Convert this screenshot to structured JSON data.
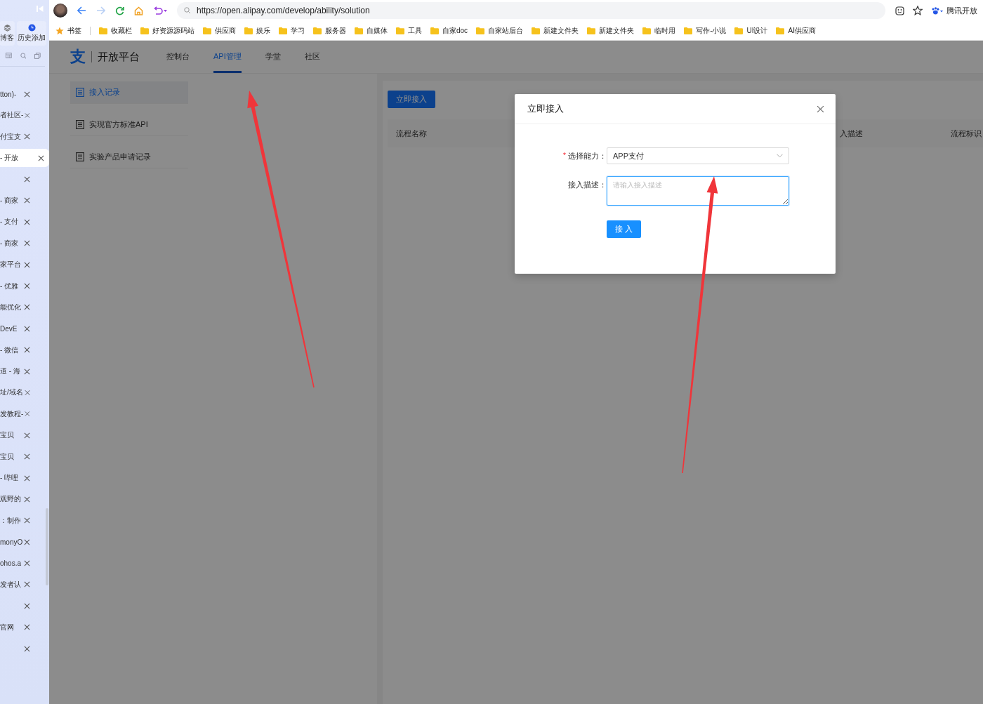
{
  "sidebar": {
    "top_buttons": [
      {
        "label": "博客"
      },
      {
        "label": "历史添加"
      }
    ],
    "tabs": [
      {
        "title": "tton)-",
        "selected": false
      },
      {
        "title": "者社区-",
        "selected": false
      },
      {
        "title": "付宝支",
        "selected": false
      },
      {
        "title": "- 开放",
        "selected": true
      },
      {
        "selected": false
      },
      {
        "title": "- 商家",
        "selected": false
      },
      {
        "title": "- 支付",
        "selected": false
      },
      {
        "title": "- 商家",
        "selected": false
      },
      {
        "title": "家平台",
        "selected": false
      },
      {
        "title": "- 优雅",
        "selected": false
      },
      {
        "title": "能优化",
        "selected": false
      },
      {
        "title": "DevE",
        "selected": false
      },
      {
        "title": "- 微信",
        "selected": false
      },
      {
        "title": "道 - 海",
        "selected": false
      },
      {
        "title": "址/域名",
        "selected": false
      },
      {
        "title": "发教程-",
        "selected": false
      },
      {
        "title": "宝贝",
        "selected": false
      },
      {
        "title": "宝贝",
        "selected": false
      },
      {
        "title": "- 哔哩",
        "selected": false
      },
      {
        "title": "观野的",
        "selected": false
      },
      {
        "title": "：制作",
        "selected": false
      },
      {
        "title": "monyO",
        "selected": false
      },
      {
        "title": "ohos.a",
        "selected": false
      },
      {
        "title": "发者认",
        "selected": false
      },
      {
        "selected": false
      },
      {
        "title": "官网",
        "selected": false
      },
      {
        "selected": false
      }
    ]
  },
  "browser": {
    "url": "https://open.alipay.com/develop/ability/solution",
    "profile_label": "腾讯开放",
    "bookmarks": [
      {
        "label": "书签",
        "kind": "star"
      },
      {
        "label": "收藏栏",
        "kind": "folder"
      },
      {
        "label": "好资源源码站",
        "kind": "folder"
      },
      {
        "label": "供应商",
        "kind": "folder"
      },
      {
        "label": "娱乐",
        "kind": "folder"
      },
      {
        "label": "学习",
        "kind": "folder"
      },
      {
        "label": "服务器",
        "kind": "folder"
      },
      {
        "label": "自媒体",
        "kind": "folder"
      },
      {
        "label": "工具",
        "kind": "folder"
      },
      {
        "label": "自家doc",
        "kind": "folder"
      },
      {
        "label": "自家站后台",
        "kind": "folder"
      },
      {
        "label": "新建文件夹",
        "kind": "folder"
      },
      {
        "label": "新建文件夹",
        "kind": "folder"
      },
      {
        "label": "临时用",
        "kind": "folder"
      },
      {
        "label": "写作-小说",
        "kind": "folder"
      },
      {
        "label": "UI设计",
        "kind": "folder"
      },
      {
        "label": "AI供应商",
        "kind": "folder"
      }
    ]
  },
  "page": {
    "logo_mark": "支",
    "logo_text": "开放平台",
    "nav": [
      {
        "label": "控制台",
        "selected": false
      },
      {
        "label": "API管理",
        "selected": true
      },
      {
        "label": "学堂",
        "selected": false
      },
      {
        "label": "社区",
        "selected": false
      }
    ],
    "menu": [
      {
        "label": "接入记录",
        "selected": true
      },
      {
        "label": "实现官方标准API",
        "selected": false
      },
      {
        "label": "实验产品申请记录",
        "selected": false
      }
    ],
    "primary_button": "立即接入",
    "table": {
      "columns": [
        "流程名称",
        "入描述",
        "流程标识"
      ]
    }
  },
  "dialog": {
    "title": "立即接入",
    "fields": [
      {
        "kind": "select",
        "required_mark": "*",
        "label": "选择能力：",
        "value": "APP支付"
      },
      {
        "kind": "textarea",
        "label": "接入描述：",
        "placeholder": "请输入接入描述"
      }
    ],
    "submit": "接 入"
  }
}
